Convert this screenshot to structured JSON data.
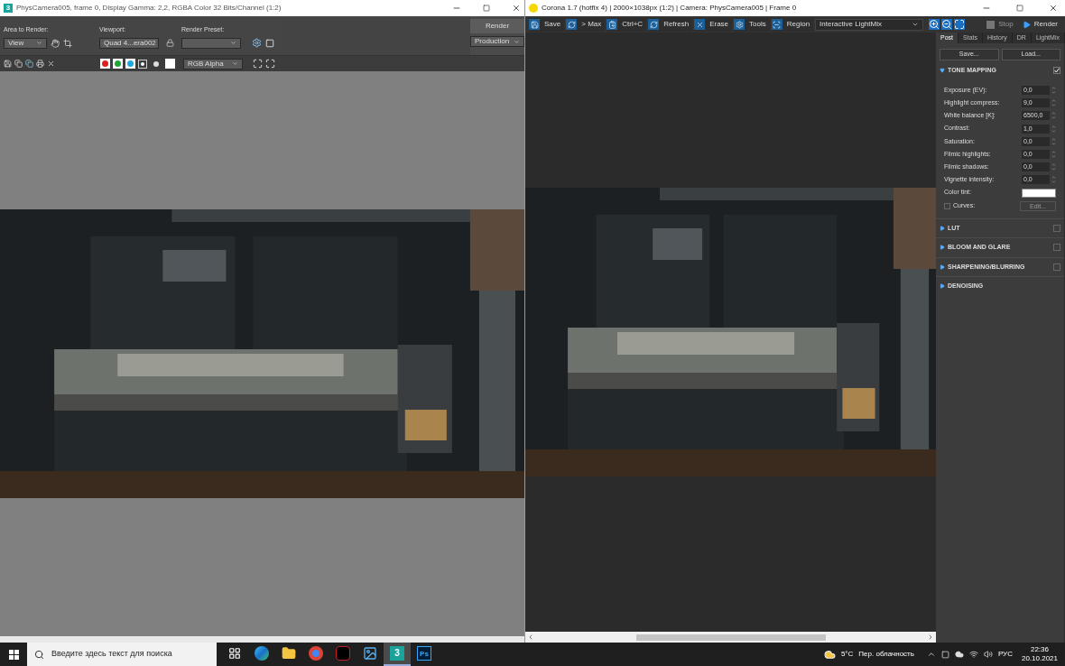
{
  "left_window": {
    "app_icon": "3",
    "title": "PhysCamera005, frame 0, Display Gamma: 2,2, RGBA Color 32 Bits/Channel (1:2)",
    "area_to_render": {
      "label": "Area to Render:",
      "value": "View"
    },
    "viewport": {
      "label": "Viewport:",
      "value": "Quad 4...era002"
    },
    "render_preset": {
      "label": "Render Preset:"
    },
    "render_button": "Render",
    "render_mode": "Production",
    "display_channel": "RGB Alpha",
    "channels": [
      {
        "color": "#e01f1f"
      },
      {
        "color": "#1fa53c"
      },
      {
        "color": "#1fa8e0"
      }
    ]
  },
  "right_window": {
    "title": "Corona 1.7 (hotfix 4) | 2000×1038px (1:2) | Camera: PhysCamera005 | Frame 0",
    "toolbar": [
      {
        "kind": "save",
        "label": "Save"
      },
      {
        "kind": "max",
        "label": "> Max"
      },
      {
        "kind": "copy",
        "label": "Ctrl+C"
      },
      {
        "kind": "refresh",
        "label": "Refresh"
      },
      {
        "kind": "erase",
        "label": "Erase"
      },
      {
        "kind": "tools",
        "label": "Tools"
      },
      {
        "kind": "region",
        "label": "Region"
      }
    ],
    "mode_select": "Interactive LightMix",
    "stop": {
      "label": "Stop",
      "disabled": true
    },
    "render": "Render",
    "panel": {
      "tabs": [
        {
          "label": "Post",
          "selected": true
        },
        {
          "label": "Stats",
          "selected": false
        },
        {
          "label": "History",
          "selected": false
        },
        {
          "label": "DR",
          "selected": false
        },
        {
          "label": "LightMix",
          "selected": false
        }
      ],
      "save": "Save...",
      "load": "Load...",
      "tone_mapping": {
        "title": "TONE MAPPING",
        "expanded": true,
        "checked": true,
        "params": [
          {
            "label": "Exposure (EV):",
            "value": "0,0"
          },
          {
            "label": "Highlight compress:",
            "value": "9,0"
          },
          {
            "label": "White balance [K]:",
            "value": "6500,0"
          },
          {
            "label": "Contrast:",
            "value": "1,0"
          },
          {
            "label": "Saturation:",
            "value": "0,0"
          },
          {
            "label": "Filmic highlights:",
            "value": "0,0"
          },
          {
            "label": "Filmic shadows:",
            "value": "0,0"
          },
          {
            "label": "Vignette intensity:",
            "value": "0,0"
          }
        ],
        "color_tint": {
          "label": "Color tint:",
          "color": "#ffffff"
        },
        "curves": {
          "label": "Curves:",
          "checked": false,
          "button": "Edit..."
        }
      },
      "sections": [
        {
          "title": "LUT",
          "expanded": false,
          "checked": false
        },
        {
          "title": "BLOOM AND GLARE",
          "expanded": false,
          "checked": false
        },
        {
          "title": "SHARPENING/BLURRING",
          "expanded": false,
          "checked": false
        },
        {
          "title": "DENOISING",
          "expanded": false
        }
      ]
    }
  },
  "taskbar": {
    "search_placeholder": "Введите здесь текст для поиска",
    "apps": [
      {
        "kind": "taskview",
        "selected": false
      },
      {
        "kind": "edge",
        "selected": false
      },
      {
        "kind": "folder",
        "selected": false
      },
      {
        "kind": "chrome",
        "selected": false
      },
      {
        "kind": "media",
        "selected": false
      },
      {
        "kind": "photos",
        "selected": false
      },
      {
        "kind": "max",
        "label": "3",
        "selected": true
      },
      {
        "kind": "ps",
        "label": "Ps",
        "selected": false
      }
    ],
    "temperature": "5°C",
    "weather": "Пер. облачность",
    "language": "РУС",
    "time": "22:36",
    "date": "20.10.2021"
  }
}
